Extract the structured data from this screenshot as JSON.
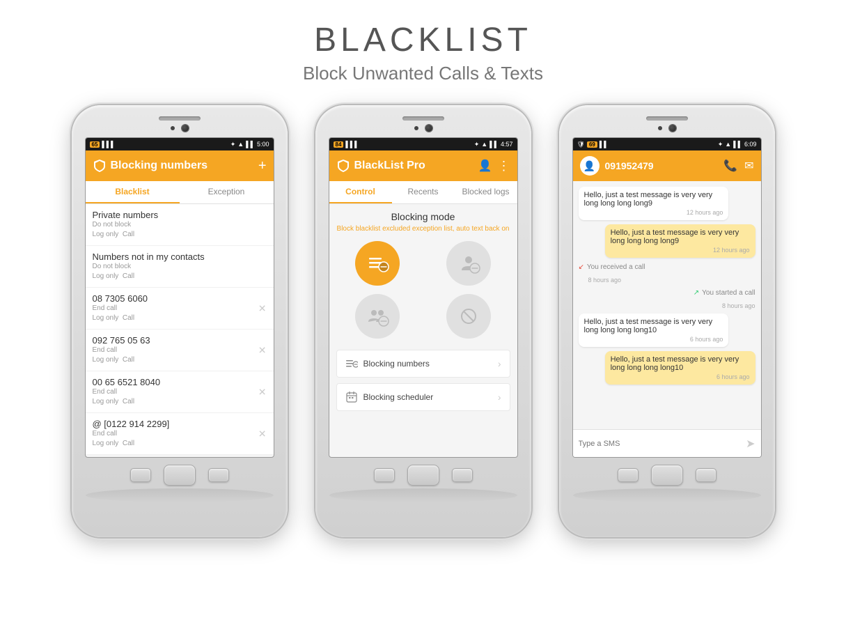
{
  "header": {
    "title": "BLACKLIST",
    "subtitle": "Block Unwanted Calls & Texts"
  },
  "phone1": {
    "statusBar": {
      "left": "65",
      "time": "5:00"
    },
    "appBar": {
      "title": "Blocking numbers",
      "addIcon": "+"
    },
    "tabs": [
      "Blacklist",
      "Exception"
    ],
    "activeTab": 0,
    "listItems": [
      {
        "title": "Private numbers",
        "subtitle": "Do not block\nLog only  Call",
        "hasX": false
      },
      {
        "title": "Numbers not in my contacts",
        "subtitle": "Do not block\nLog only  Call",
        "hasX": false
      },
      {
        "title": "08 7305 6060",
        "subtitle": "End call\nLog only  Call",
        "hasX": true
      },
      {
        "title": "092 765 05 63",
        "subtitle": "End call\nLog only  Call",
        "hasX": true
      },
      {
        "title": "00 65 6521 8040",
        "subtitle": "End call\nLog only  Call",
        "hasX": true
      },
      {
        "title": "@ [0122 914 2299]",
        "subtitle": "End call\nLog only  Call",
        "hasX": true
      }
    ]
  },
  "phone2": {
    "statusBar": {
      "left": "84",
      "time": "4:57"
    },
    "appBar": {
      "title": "BlackList Pro"
    },
    "tabs": [
      "Control",
      "Recents",
      "Blocked logs"
    ],
    "activeTab": 0,
    "blockingMode": {
      "title": "Blocking mode",
      "description": "Block blacklist excluded exception list, auto text back on"
    },
    "bottomItems": [
      {
        "icon": "list-icon",
        "label": "Blocking numbers"
      },
      {
        "icon": "calendar-icon",
        "label": "Blocking scheduler"
      }
    ]
  },
  "phone3": {
    "statusBar": {
      "left": "69",
      "time": "6:09"
    },
    "contactNumber": "091952479",
    "messages": [
      {
        "type": "left",
        "text": "Hello, just a test message is very very long long long long9",
        "time": "12 hours ago"
      },
      {
        "type": "right",
        "text": "Hello, just a test message is very very long long long long9",
        "time": "12 hours ago"
      },
      {
        "type": "call-in",
        "text": "You received a call",
        "time": "8 hours ago"
      },
      {
        "type": "call-out",
        "text": "You started a call",
        "time": "8 hours ago"
      },
      {
        "type": "left",
        "text": "Hello, just a test message is very very long long long long10",
        "time": "6 hours ago"
      },
      {
        "type": "right",
        "text": "Hello, just a test message is very very long long long long10",
        "time": "6 hours ago"
      }
    ],
    "inputPlaceholder": "Type a SMS"
  }
}
